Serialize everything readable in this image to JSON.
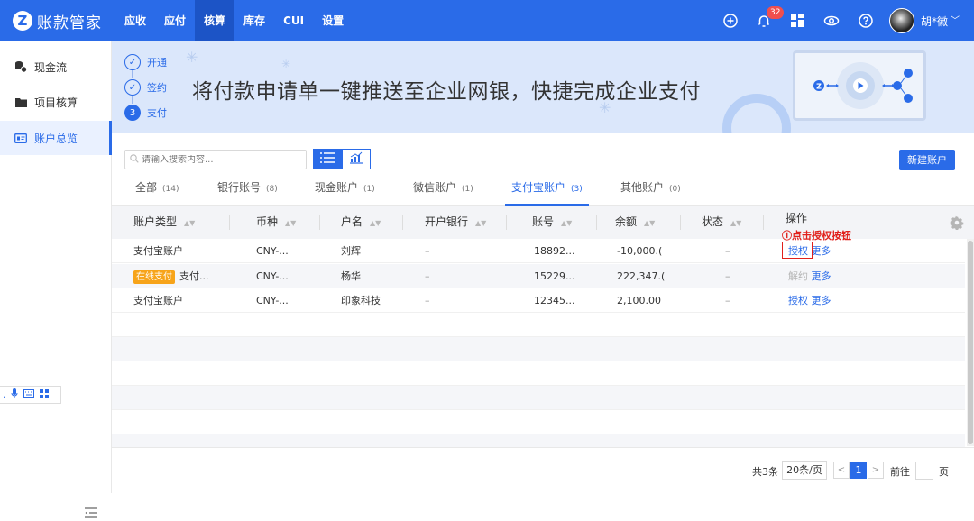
{
  "app": {
    "logo_letter": "Z",
    "title": "账款管家"
  },
  "nav": [
    "应收",
    "应付",
    "核算",
    "库存",
    "CUI",
    "设置"
  ],
  "nav_active": "核算",
  "header": {
    "notification_count": "32",
    "user_name": "胡*徽"
  },
  "sidebar": {
    "items": [
      {
        "label": "现金流",
        "icon": "cash-flow-icon"
      },
      {
        "label": "项目核算",
        "icon": "folder-icon"
      },
      {
        "label": "账户总览",
        "icon": "card-icon"
      }
    ],
    "active": "账户总览"
  },
  "banner": {
    "steps": [
      {
        "label": "开通",
        "mark": "✓"
      },
      {
        "label": "签约",
        "mark": "✓"
      },
      {
        "label": "支付",
        "mark": "3"
      }
    ],
    "title": "将付款申请单一键推送至企业网银，快捷完成企业支付"
  },
  "search": {
    "placeholder": "请输入搜索内容..."
  },
  "toolbar": {
    "new_account": "新建账户"
  },
  "tabs": [
    {
      "label": "全部",
      "count": "(14)"
    },
    {
      "label": "银行账号",
      "count": "(8)"
    },
    {
      "label": "现金账户",
      "count": "(1)"
    },
    {
      "label": "微信账户",
      "count": "(1)"
    },
    {
      "label": "支付宝账户",
      "count": "(3)"
    },
    {
      "label": "其他账户",
      "count": "(0)"
    }
  ],
  "active_tab": "支付宝账户",
  "table": {
    "columns": [
      "账户类型",
      "币种",
      "户名",
      "开户银行",
      "账号",
      "余额",
      "状态",
      "操作"
    ],
    "rows": [
      {
        "tag": "",
        "type": "支付宝账户",
        "currency": "CNY-...",
        "name": "刘辉",
        "bank": "–",
        "account": "18892...",
        "balance": "-10,000.(",
        "status": "–",
        "action1": "授权",
        "action1_disabled": false,
        "action2": "更多"
      },
      {
        "tag": "在线支付",
        "type": "支付...",
        "currency": "CNY-...",
        "name": "杨华",
        "bank": "–",
        "account": "15229...",
        "balance": "222,347.(",
        "status": "–",
        "action1": "解约",
        "action1_disabled": true,
        "action2": "更多"
      },
      {
        "tag": "",
        "type": "支付宝账户",
        "currency": "CNY-...",
        "name": "印象科技",
        "bank": "–",
        "account": "12345...",
        "balance": "2,100.00",
        "status": "–",
        "action1": "授权",
        "action1_disabled": false,
        "action2": "更多"
      }
    ]
  },
  "annotation": "①点击授权按钮",
  "pagination": {
    "total": "共3条",
    "page_size": "20条/页",
    "current": "1",
    "goto": "前往",
    "page_unit": "页"
  }
}
